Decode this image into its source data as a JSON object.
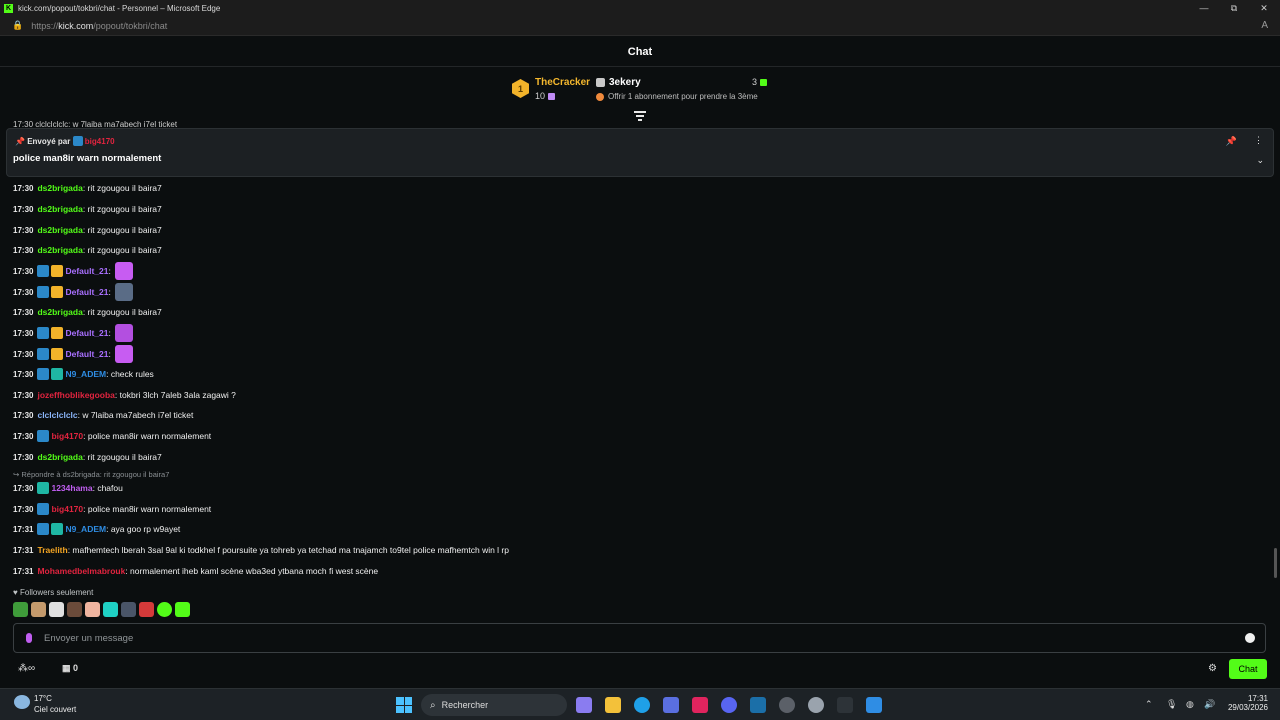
{
  "browser": {
    "title": "kick.com/popout/tokbri/chat - Personnel – Microsoft Edge",
    "url_prefix": "https://",
    "url_host": "kick.com",
    "url_path": "/popout/tokbri/chat",
    "controls": [
      "—",
      "⧉",
      "✕"
    ]
  },
  "chat": {
    "title": "Chat",
    "leaderboard": {
      "rank": "1",
      "first_name": "TheCracker",
      "first_count": "10",
      "second_name": "3ekery",
      "second_count": "3",
      "offer_text": "Offrir 1 abonnement pour prendre la 3ème"
    },
    "peek_line": "17:30 clclclclclc: w 7laiba ma7abech i7el ticket",
    "pinned": {
      "sent_by": "Envoyé par",
      "author": "big4170",
      "text": "police man8ir warn normalement"
    },
    "messages": [
      {
        "time": "17:30",
        "user": "ds2brigada",
        "color": "#53fc18",
        "badges": [],
        "text": ": rit zgougou il baira7"
      },
      {
        "time": "17:30",
        "user": "ds2brigada",
        "color": "#53fc18",
        "badges": [],
        "text": ": rit zgougou il baira7"
      },
      {
        "time": "17:30",
        "user": "ds2brigada",
        "color": "#53fc18",
        "badges": [],
        "text": ": rit zgougou il baira7"
      },
      {
        "time": "17:30",
        "user": "ds2brigada",
        "color": "#53fc18",
        "badges": [],
        "text": ": rit zgougou il baira7"
      },
      {
        "time": "17:30",
        "user": "Default_21",
        "color": "#a970ff",
        "badges": [
          "mod",
          "crown"
        ],
        "text": ":",
        "emote": "#c75cf2"
      },
      {
        "time": "17:30",
        "user": "Default_21",
        "color": "#a970ff",
        "badges": [
          "mod",
          "crown"
        ],
        "text": ":",
        "emote": "#5a6c86"
      },
      {
        "time": "17:30",
        "user": "ds2brigada",
        "color": "#53fc18",
        "badges": [],
        "text": ": rit zgougou il baira7"
      },
      {
        "time": "17:30",
        "user": "Default_21",
        "color": "#a970ff",
        "badges": [
          "mod",
          "crown"
        ],
        "text": ":",
        "emote": "#b34fe0"
      },
      {
        "time": "17:30",
        "user": "Default_21",
        "color": "#a970ff",
        "badges": [
          "mod",
          "crown"
        ],
        "text": ":",
        "emote": "#c75cf2"
      },
      {
        "time": "17:30",
        "user": "N9_ADEM",
        "color": "#2f8de4",
        "badges": [
          "mod",
          "sub"
        ],
        "text": ": check rules"
      },
      {
        "time": "17:30",
        "user": "jozeffhoblikegooba",
        "color": "#e2243f",
        "badges": [],
        "text": ": tokbri 3lch 7aleb 3ala zagawi ?"
      },
      {
        "time": "17:30",
        "user": "clclclclclc",
        "color": "#8ab4f8",
        "badges": [],
        "text": ": w 7laiba ma7abech i7el ticket"
      },
      {
        "time": "17:30",
        "user": "big4170",
        "color": "#e2243f",
        "badges": [
          "mod"
        ],
        "text": ": police man8ir warn normalement"
      },
      {
        "time": "17:30",
        "user": "ds2brigada",
        "color": "#53fc18",
        "badges": [],
        "text": ": rit zgougou il baira7"
      },
      {
        "time": "17:30",
        "user": "1234hama",
        "color": "#c05ef0",
        "badges": [
          "sub"
        ],
        "text": ": chafou"
      },
      {
        "time": "17:30",
        "user": "big4170",
        "color": "#e2243f",
        "badges": [
          "mod"
        ],
        "text": ": police man8ir warn normalement"
      },
      {
        "time": "17:31",
        "user": "N9_ADEM",
        "color": "#2f8de4",
        "badges": [
          "mod",
          "sub"
        ],
        "text": ": aya goo rp w9ayet"
      },
      {
        "time": "17:31",
        "user": "Traelith",
        "color": "#f5a623",
        "badges": [],
        "text": ": mafhemtech lberah 3sal 9al ki todkhel f poursuite ya tohreb ya tetchad ma tnajamch to9tel police mafhemtch win l rp"
      },
      {
        "time": "17:31",
        "user": "Mohamedbelmabrouk",
        "color": "#e2243f",
        "badges": [],
        "text": ": normalement iheb kaml scène wba3ed ytbana moch fi west scène"
      }
    ],
    "reply_hint": "Répondre à ds2brigada: rit zgougou il baira7",
    "followers_only": "Followers seulement",
    "input_placeholder": "Envoyer un message",
    "points": "0",
    "send_label": "Chat"
  },
  "taskbar": {
    "temp": "17°C",
    "weather": "Ciel couvert",
    "search_label": "Rechercher",
    "time": "17:31",
    "date": "29/03/2026"
  }
}
